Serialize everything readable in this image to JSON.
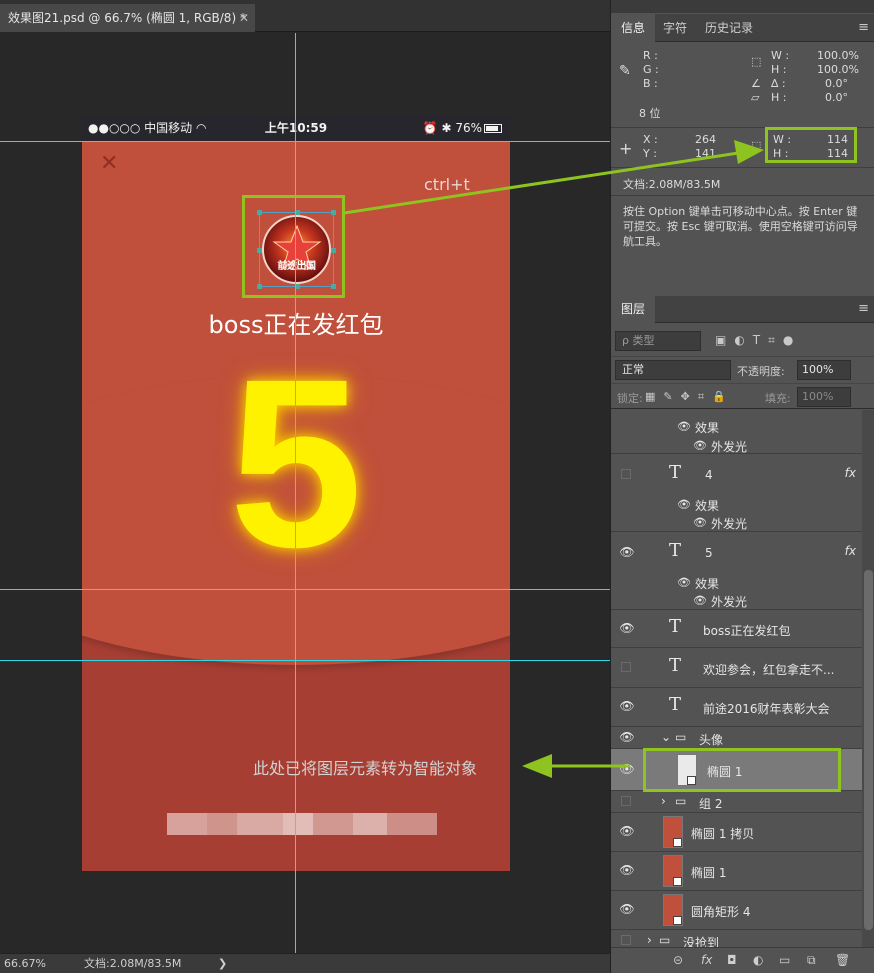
{
  "document": {
    "tab_title": "效果图21.psd @ 66.7% (椭圆 1, RGB/8) *",
    "tab_close": "✕"
  },
  "phone": {
    "status_left": "●●○○○ 中国移动 ◠",
    "status_time": "上午10:59",
    "status_right": "⏰ ✱ 76%",
    "close_glyph": "✕",
    "avatar_caption": "前途出国",
    "title": "boss正在发红包",
    "big_number": "5",
    "colors": {
      "red_top": "#c04f3b",
      "red_bottom": "#a63e33",
      "number": "#fff200"
    }
  },
  "annotations": {
    "shortcut_hint": "ctrl+t",
    "smart_object_note": "此处已将图层元素转为智能对象",
    "highlight_color": "#8fc31f"
  },
  "statusbar": {
    "zoom": "66.67%",
    "doc_size": "文档:2.08M/83.5M",
    "nav_arrow": "❯"
  },
  "info_panel": {
    "tabs": [
      "信息",
      "字符",
      "历史记录"
    ],
    "rgb_labels": {
      "r": "R :",
      "g": "G :",
      "b": "B :"
    },
    "bit_depth": "8 位",
    "transform": {
      "w_label": "W :",
      "w_value": "100.0%",
      "h_label": "H :",
      "h_value": "100.0%",
      "angle_label": "∆ :",
      "angle_value": "0.0°",
      "skew_label": "H :",
      "skew_value": "0.0°"
    },
    "position": {
      "x_label": "X :",
      "x_value": "264",
      "y_label": "Y :",
      "y_value": "141"
    },
    "size": {
      "w_label": "W :",
      "w_value": "114",
      "h_label": "H :",
      "h_value": "114"
    },
    "doc_size": "文档:2.08M/83.5M",
    "hint": "按住 Option 键单击可移动中心点。按 Enter 键可提交。按 Esc 键可取消。使用空格键可访问导航工具。"
  },
  "layers_panel": {
    "tab": "图层",
    "filter_placeholder": "ρ 类型",
    "blend_mode": "正常",
    "opacity_label": "不透明度:",
    "opacity_value": "100%",
    "lock_label": "锁定:",
    "fill_label": "填充:",
    "fill_value": "100%",
    "effects_label": "效果",
    "outer_glow_label": "外发光",
    "fx": "fx",
    "layers": {
      "text_4": "4",
      "text_5": "5",
      "text_boss": "boss正在发红包",
      "text_welcome": "欢迎参会，红包拿走不...",
      "text_meeting": "前途2016财年表彰大会",
      "group_avatar": "头像",
      "ellipse_1_smart": "椭圆 1",
      "group_2": "组 2",
      "ellipse_1_copy": "椭圆 1 拷贝",
      "ellipse_1": "椭圆 1",
      "rounded_rect_4": "圆角矩形 4",
      "group_not_grabbed": "没抢到"
    },
    "footer_icons": [
      "link-icon",
      "fx-icon",
      "mask-icon",
      "adjustment-icon",
      "folder-icon",
      "new-layer-icon",
      "trash-icon"
    ]
  }
}
